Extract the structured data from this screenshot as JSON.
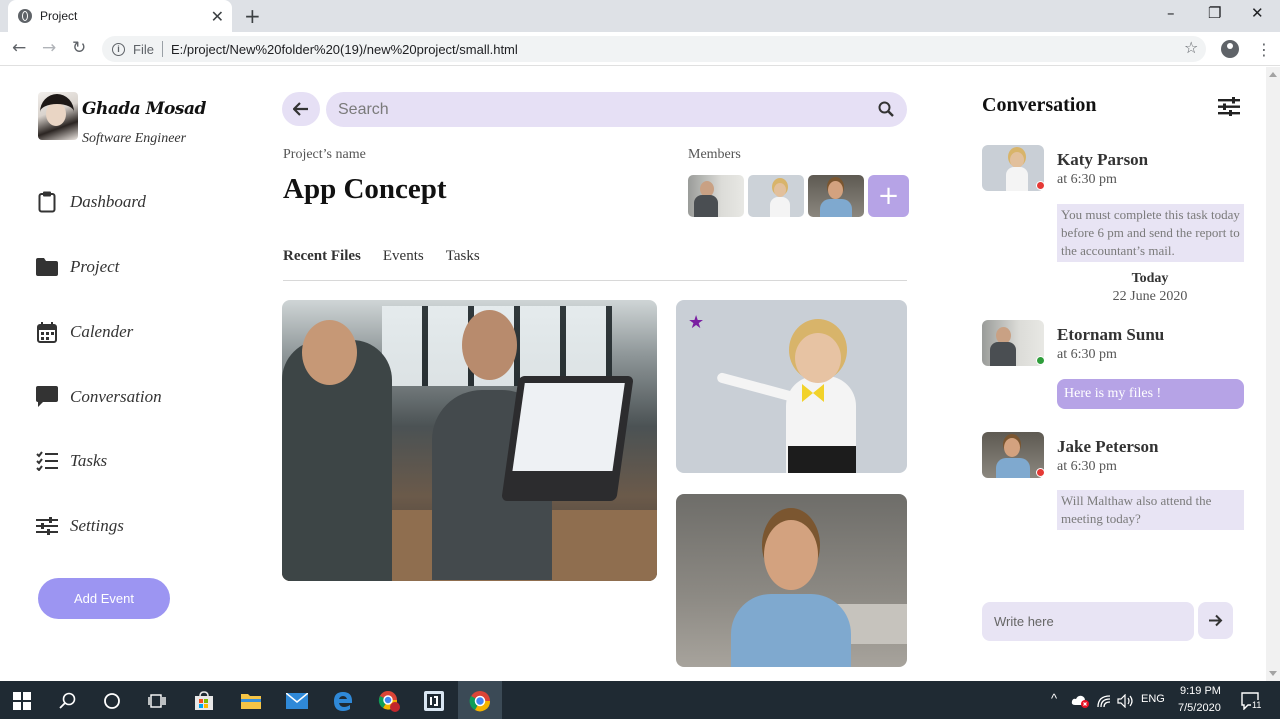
{
  "browser": {
    "tab_title": "Project",
    "tab_close": "✕",
    "new_tab": "+",
    "file_label": "File",
    "url": "E:/project/New%20folder%20(19)/new%20project/small.html",
    "win_minimize": "–",
    "win_maximize": "❐",
    "win_close": "✕"
  },
  "profile": {
    "name": "Ghada Mosad",
    "role": "Software Engineer"
  },
  "sidebar": {
    "items": [
      {
        "label": "Dashboard",
        "icon": "clipboard-icon"
      },
      {
        "label": "Project",
        "icon": "folder-icon"
      },
      {
        "label": "Calender",
        "icon": "calendar-icon"
      },
      {
        "label": "Conversation",
        "icon": "chat-icon"
      },
      {
        "label": "Tasks",
        "icon": "tasks-icon"
      },
      {
        "label": "Settings",
        "icon": "sliders-icon"
      }
    ],
    "add_event": "Add Event"
  },
  "search": {
    "placeholder": "Search"
  },
  "project": {
    "label": "Project’s name",
    "title": "App Concept",
    "members_label": "Members",
    "add_member": "+"
  },
  "tabs": [
    "Recent Files",
    "Events",
    "Tasks"
  ],
  "conversation": {
    "title": "Conversation",
    "messages": [
      {
        "name": "Katy Parson",
        "time": "at 6:30 pm",
        "text": "You must complete this task today before 6 pm and send the report to the accountant’s mail.",
        "status_color": "#e53935"
      },
      {
        "name": "Etornam Sunu",
        "time": "at 6:30 pm",
        "text": "Here is my files !",
        "status_color": "#2e9d3a"
      },
      {
        "name": "Jake Peterson",
        "time": "at 6:30 pm",
        "text": "Will Malthaw also attend the meeting today?",
        "status_color": "#e53935"
      }
    ],
    "today_label": "Today",
    "today_date": "22 June 2020",
    "write_placeholder": "Write here"
  },
  "taskbar": {
    "language": "ENG",
    "time": "9:19 PM",
    "date": "7/5/2020",
    "notification_count": "11"
  },
  "colors": {
    "accent": "#9c95f2",
    "bubble_purple": "#b6a3e6",
    "input_bg": "#e6e0f5",
    "star": "#7b1fa2"
  }
}
